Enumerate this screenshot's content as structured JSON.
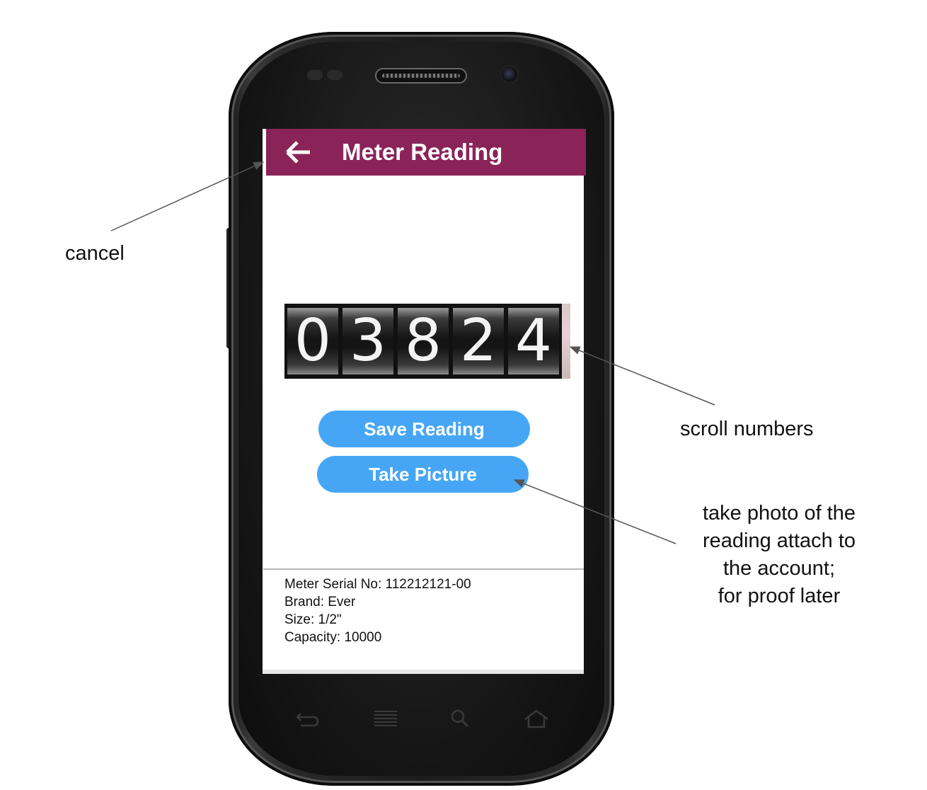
{
  "app_bar": {
    "title": "Meter Reading",
    "back_icon": "arrow-left-icon",
    "color": "#8a2458"
  },
  "meter_reading": {
    "digits": [
      "0",
      "3",
      "8",
      "2",
      "4"
    ]
  },
  "buttons": {
    "save_label": "Save Reading",
    "photo_label": "Take Picture",
    "color": "#46a6f5"
  },
  "meter_info": {
    "serial": "Meter Serial No: 112212121-00",
    "brand": "Brand: Ever",
    "size": "Size: 1/2\"",
    "capacity": "Capacity: 10000"
  },
  "nav_bar": {
    "icons": [
      "back-icon",
      "menu-icon",
      "search-icon",
      "home-icon"
    ]
  },
  "annotations": {
    "cancel": "cancel",
    "scroll": "scroll numbers",
    "photo_lines": [
      "take photo of the",
      "reading attach to",
      "the account;",
      "for proof later"
    ]
  }
}
